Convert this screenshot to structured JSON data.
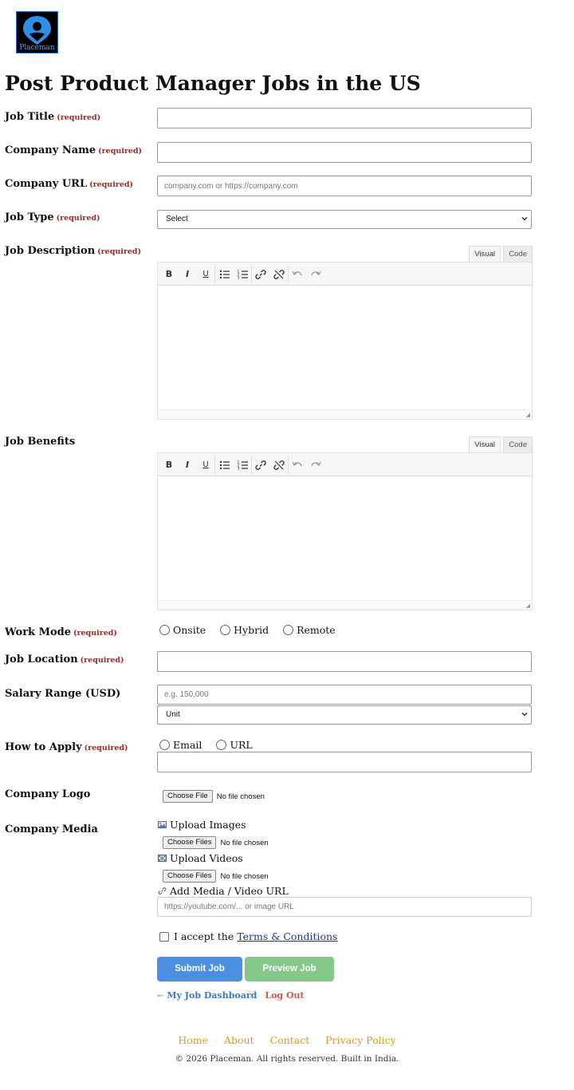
{
  "logo": {
    "text": "Placeman"
  },
  "page_title": "Post Product Manager Jobs in the US",
  "required_tag": "(required)",
  "fields": {
    "job_title": {
      "label": "Job Title",
      "value": ""
    },
    "company_name": {
      "label": "Company Name",
      "value": ""
    },
    "company_url": {
      "label": "Company URL",
      "placeholder": "company.com or https://company.com"
    },
    "job_type": {
      "label": "Job Type",
      "selected": "Select"
    },
    "job_description": {
      "label": "Job Description"
    },
    "job_benefits": {
      "label": "Job Benefits"
    },
    "work_mode": {
      "label": "Work Mode",
      "options": [
        "Onsite",
        "Hybrid",
        "Remote"
      ]
    },
    "job_location": {
      "label": "Job Location",
      "value": ""
    },
    "salary_range": {
      "label": "Salary Range (USD)",
      "placeholder": "e.g. 150,000",
      "unit_selected": "Unit"
    },
    "how_to_apply": {
      "label": "How to Apply",
      "options": [
        "Email",
        "URL"
      ]
    },
    "company_logo": {
      "label": "Company Logo",
      "button": "Choose File",
      "status": "No file chosen"
    },
    "company_media": {
      "label": "Company Media",
      "upload_images": "Upload Images",
      "upload_videos": "Upload Videos",
      "choose_files": "Choose Files",
      "status": "No file chosen",
      "add_media_url": "Add Media / Video URL",
      "media_url_placeholder": "https://youtube.com/... or image URL"
    }
  },
  "editor": {
    "visual_tab": "Visual",
    "code_tab": "Code"
  },
  "terms": {
    "prefix": "I accept the",
    "link": "Terms & Conditions"
  },
  "buttons": {
    "submit": "Submit Job",
    "preview": "Preview Job"
  },
  "links": {
    "arrow": "←",
    "dashboard": "My Job Dashboard",
    "logout": "Log Out"
  },
  "footer": {
    "links": [
      "Home",
      "About",
      "Contact",
      "Privacy Policy"
    ],
    "copyright": "© 2026 Placeman. All rights reserved. Built in India."
  },
  "colors": {
    "required": "#b22222",
    "submit_button": "#4a90e2",
    "preview_button": "#86c88a",
    "footer_link": "#d89a1e",
    "dashboard_link": "#3a7bc8",
    "logout_link": "#d9534f"
  }
}
